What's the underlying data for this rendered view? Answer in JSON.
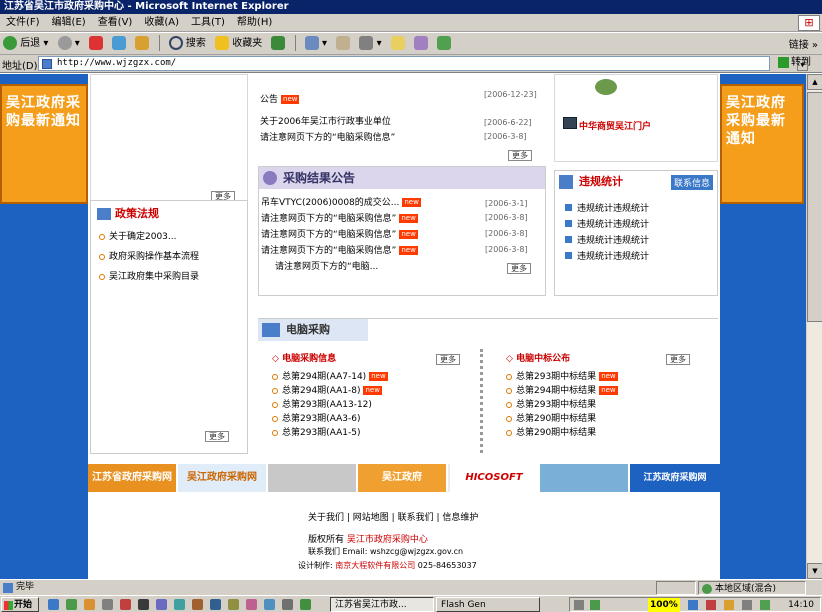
{
  "window": {
    "title": "江苏省吴江市政府采购中心 - Microsoft Internet Explorer"
  },
  "menu": [
    "文件(F)",
    "编辑(E)",
    "查看(V)",
    "收藏(A)",
    "工具(T)",
    "帮助(H)"
  ],
  "toolbar": {
    "back": "后退",
    "search": "搜索",
    "favorites": "收藏夹",
    "links": "链接"
  },
  "address": {
    "label": "地址(D)",
    "url": "http://www.wjzgzx.com/",
    "go": "转到"
  },
  "banners": {
    "left": "吴江政府采购最新通知",
    "right": "吴江政府采购最新通知"
  },
  "top_list": {
    "items": [
      {
        "text": "公告",
        "date": "[2006-12-23]"
      },
      {
        "text": "关于2006年吴江市行政事业单位",
        "date": "[2006-6-22]"
      },
      {
        "text": "请注意网页下方的“电脑采购信息”",
        "date": "[2006-3-8]"
      }
    ],
    "more": "更多"
  },
  "policy": {
    "title": "政策法规",
    "items": [
      "关于确定2003...",
      "政府采购操作基本流程",
      "吴江政府集中采购目录"
    ],
    "more": "更多"
  },
  "left_top_more": "更多",
  "results": {
    "title": "采购结果公告",
    "items": [
      {
        "text": "吊车VTYC(2006)0008的成交公...",
        "date": "[2006-3-1]"
      },
      {
        "text": "请注意网页下方的“电脑采购信息”",
        "date": "[2006-3-8]"
      },
      {
        "text": "请注意网页下方的“电脑采购信息”",
        "date": "[2006-3-8]"
      },
      {
        "text": "请注意网页下方的“电脑采购信息”",
        "date": "[2006-3-8]"
      },
      {
        "text": "请注意网页下方的“电脑...",
        "date": ""
      }
    ],
    "more": "更多"
  },
  "stats": {
    "title": "违规统计",
    "tab": "联系信息",
    "items": [
      "违规统计违规统计",
      "违规统计违规统计",
      "违规统计违规统计",
      "违规统计违规统计"
    ],
    "banner": "中华商贸吴江门户"
  },
  "computer": {
    "title": "电脑采购",
    "info": {
      "title": "电脑采购信息",
      "more": "更多",
      "items": [
        "总第294期(AA7-14)",
        "总第294期(AA1-8)",
        "总第293期(AA13-12)",
        "总第293期(AA3-6)",
        "总第293期(AA1-5)"
      ]
    },
    "winning": {
      "title": "电脑中标公布",
      "more": "更多",
      "items": [
        "总第293期中标结果",
        "总第294期中标结果",
        "总第293期中标结果",
        "总第290期中标结果",
        "总第290期中标结果"
      ]
    }
  },
  "logos": [
    "江苏省政府采购网",
    "吴江政府采购网",
    "",
    "吴江政府",
    "",
    "HICOSOFT",
    "",
    "江苏政府采购网"
  ],
  "footer": {
    "links": [
      "关于我们",
      "网站地图",
      "联系我们",
      "信息维护"
    ],
    "copyright_label": "版权所有",
    "org": "吴江市政府采购中心",
    "contact_label": "联系我们",
    "email": "Email: wshzcg@wjzgzx.gov.cn",
    "design_label": "设计制作:",
    "design_company": "南京大程软件有限公司",
    "phone": "025-84653037"
  },
  "status": {
    "text": "完毕",
    "zone": "本地区域(混合)"
  },
  "taskbar": {
    "start": "开始",
    "tasks": [
      "江苏省吴江市政...",
      "Flash Gen"
    ],
    "input": "100%",
    "time": "14:10"
  },
  "colors": {
    "accent_blue": "#1d62c1",
    "banner_orange": "#f49e1c",
    "title_blue": "#0a246a"
  }
}
